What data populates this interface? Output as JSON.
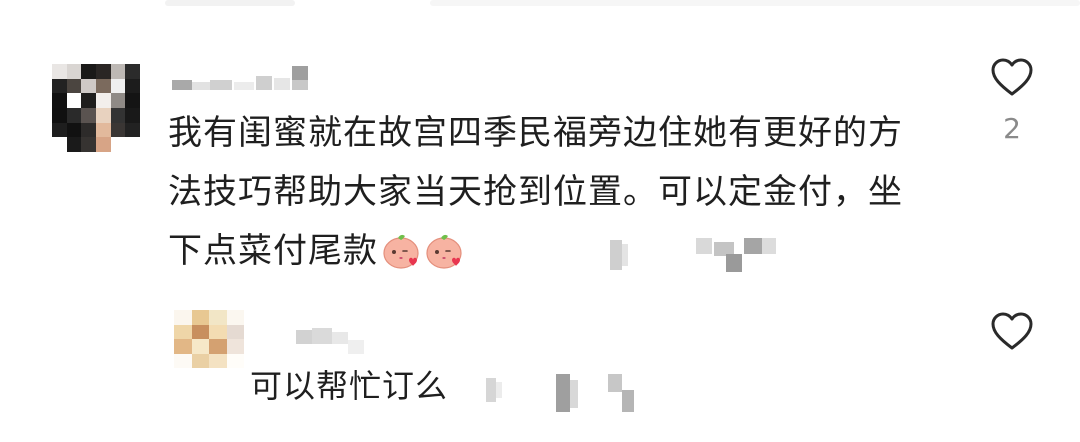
{
  "comment": {
    "text": "我有闺蜜就在故宫四季民福旁边住她有更好的方法技巧帮助大家当天抢到位置。可以定金付，坐下点菜付尾款",
    "like_count": "2",
    "emoji_count": 2
  },
  "reply": {
    "text": "可以帮忙订么"
  },
  "icons": {
    "like": "heart-outline-icon",
    "emoji": "kissing-peach-emoji"
  },
  "colors": {
    "text": "#1f1f1f",
    "muted": "#8a8a8a"
  }
}
